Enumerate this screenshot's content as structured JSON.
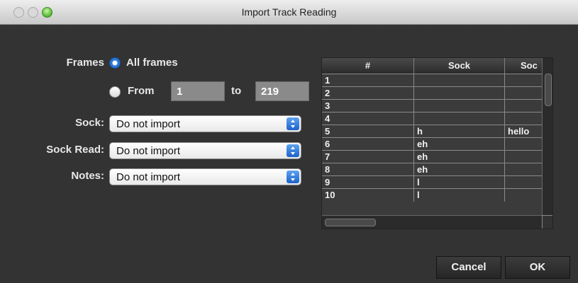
{
  "window": {
    "title": "Import Track Reading"
  },
  "frames": {
    "label": "Frames",
    "all_label": "All frames",
    "from_label": "From",
    "to_label": "to",
    "from_value": "1",
    "to_value": "219",
    "selected": "all"
  },
  "fields": [
    {
      "label": "Sock:",
      "value": "Do not import"
    },
    {
      "label": "Sock Read:",
      "value": "Do not import"
    },
    {
      "label": "Notes:",
      "value": "Do not import"
    }
  ],
  "table": {
    "columns": [
      "#",
      "Sock",
      "Soc"
    ],
    "rows": [
      [
        "1",
        "",
        ""
      ],
      [
        "2",
        "",
        ""
      ],
      [
        "3",
        "",
        ""
      ],
      [
        "4",
        "",
        ""
      ],
      [
        "5",
        "h",
        "hello"
      ],
      [
        "6",
        "eh",
        ""
      ],
      [
        "7",
        "eh",
        ""
      ],
      [
        "8",
        "eh",
        ""
      ],
      [
        "9",
        "l",
        ""
      ],
      [
        "10",
        "l",
        ""
      ]
    ]
  },
  "buttons": {
    "cancel": "Cancel",
    "ok": "OK"
  },
  "colors": {
    "accent": "#2a78d6",
    "background": "#333333"
  }
}
